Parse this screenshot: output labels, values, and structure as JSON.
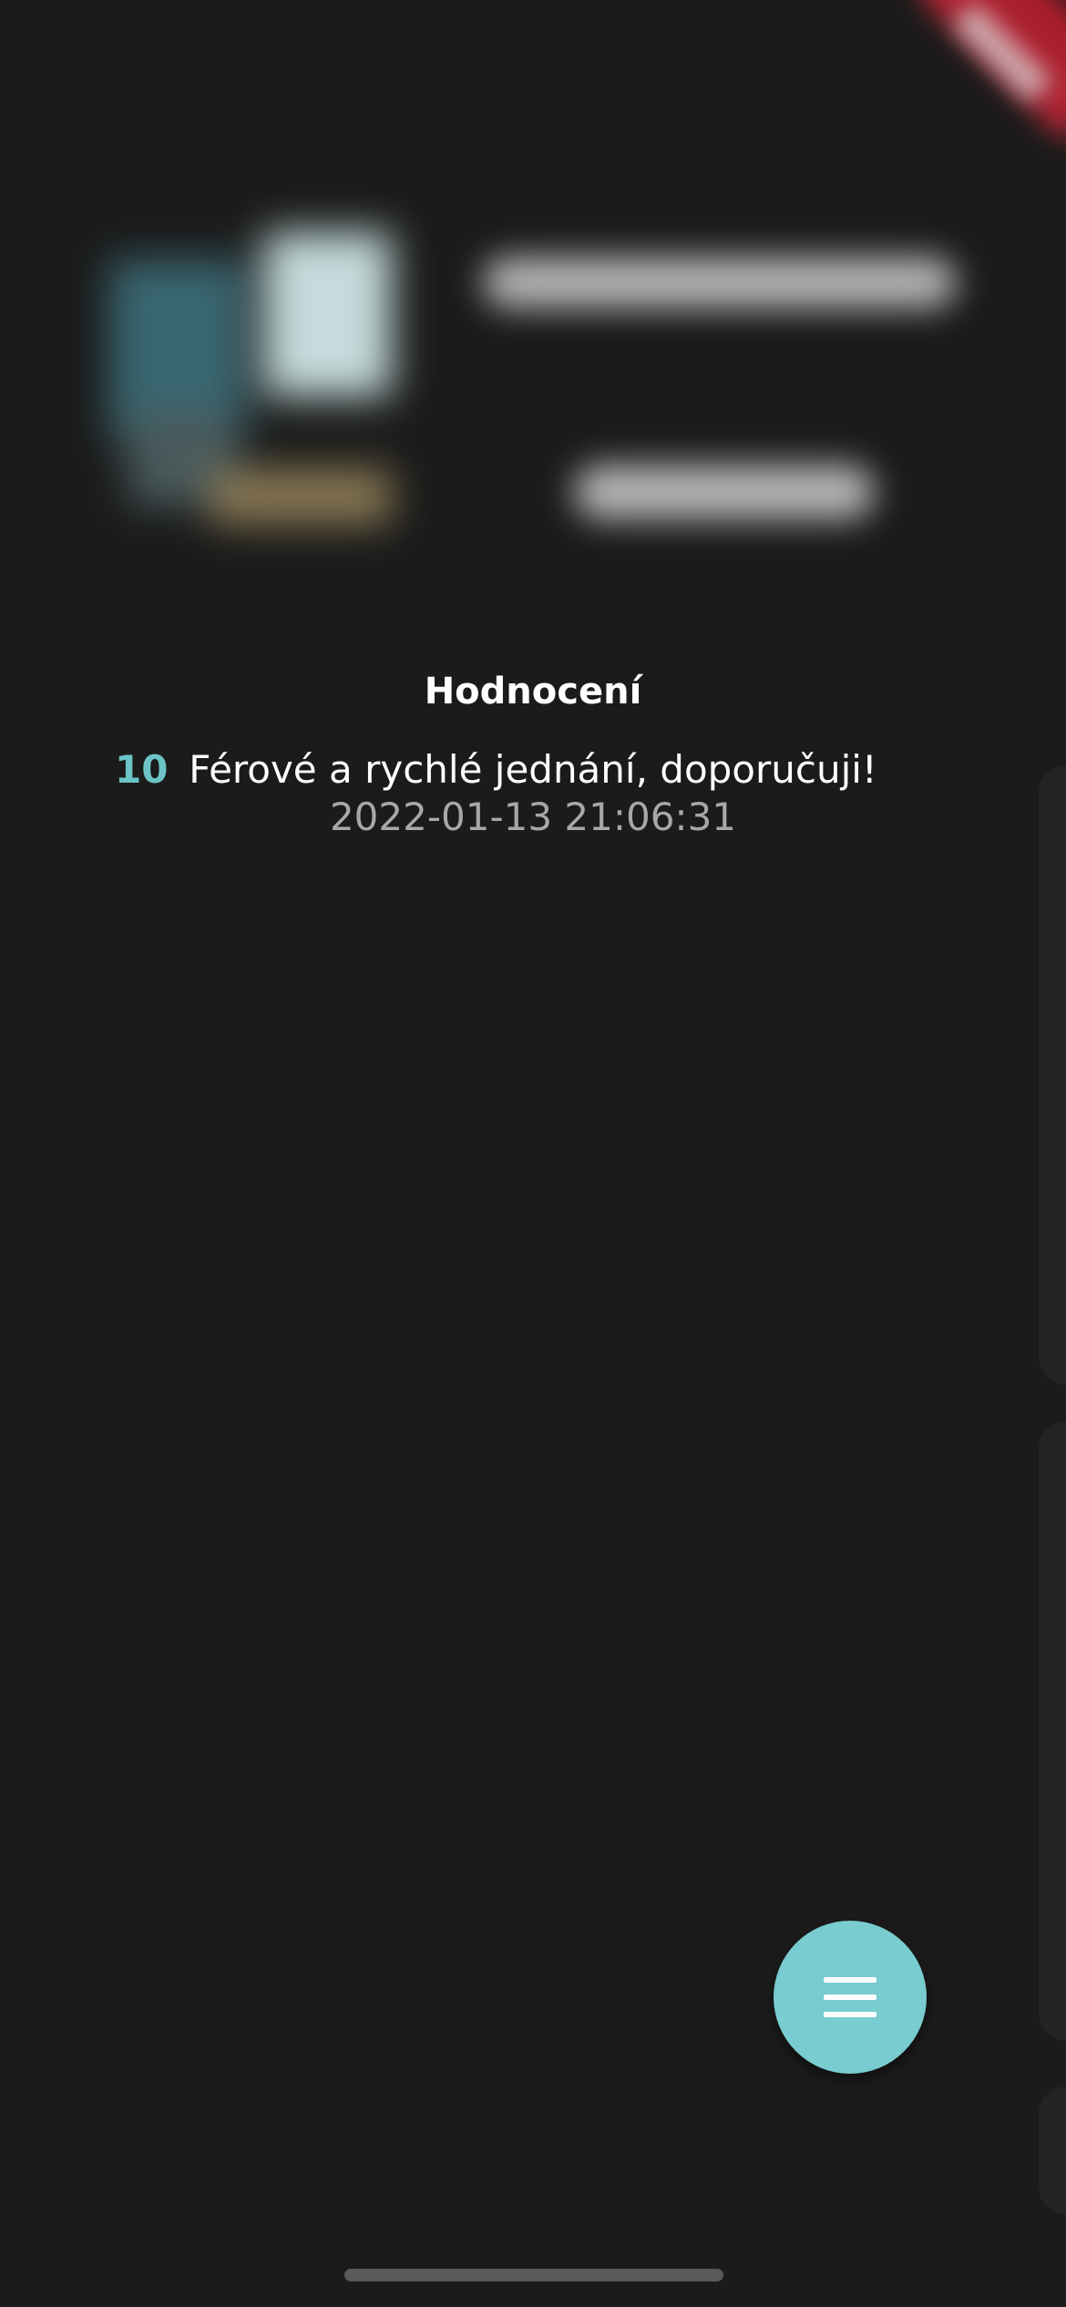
{
  "ratings": {
    "title": "Hodnocení",
    "items": [
      {
        "score": "10",
        "text": "Férové a rychlé jednání, doporučuji!",
        "date": "2022-01-13 21:06:31"
      }
    ]
  },
  "fab": {
    "icon": "menu-icon"
  },
  "colors": {
    "background": "#1b1b1b",
    "accent": "#79cccf",
    "score": "#6cc4c7",
    "secondary_text": "#a8a8a8"
  }
}
